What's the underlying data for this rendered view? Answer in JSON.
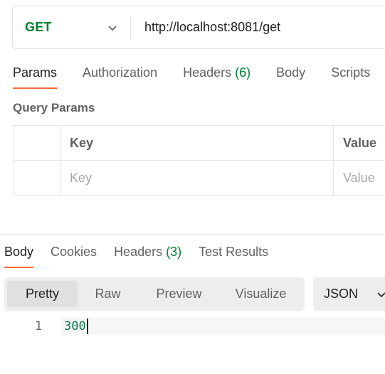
{
  "request": {
    "method": "GET",
    "url": "http://localhost:8081/get"
  },
  "request_tabs": [
    {
      "label": "Params",
      "active": true
    },
    {
      "label": "Authorization"
    },
    {
      "label": "Headers",
      "count": "(6)"
    },
    {
      "label": "Body"
    },
    {
      "label": "Scripts"
    }
  ],
  "query_params": {
    "title": "Query Params",
    "header_key": "Key",
    "header_value": "Value",
    "placeholder_key": "Key",
    "placeholder_value": "Value"
  },
  "response_tabs": [
    {
      "label": "Body",
      "active": true
    },
    {
      "label": "Cookies"
    },
    {
      "label": "Headers",
      "count": "(3)"
    },
    {
      "label": "Test Results"
    }
  ],
  "view_modes": [
    "Pretty",
    "Raw",
    "Preview",
    "Visualize"
  ],
  "active_view": "Pretty",
  "format": "JSON",
  "response_body": {
    "line_number": "1",
    "content": "300"
  },
  "colors": {
    "method_green": "#007f31",
    "accent_orange": "#ff6c37",
    "count_green": "#007f31",
    "code_green": "#0b7a4b"
  }
}
